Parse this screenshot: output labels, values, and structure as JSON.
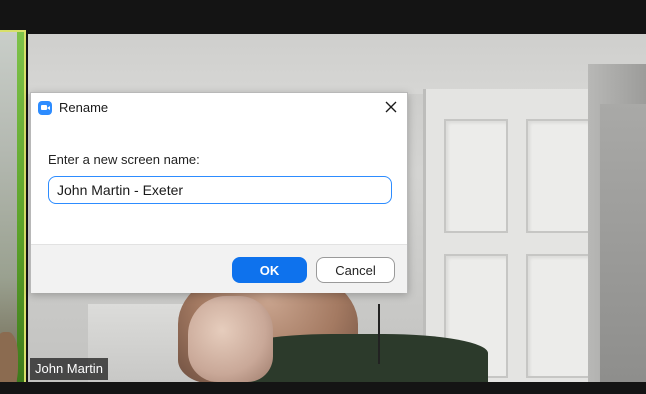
{
  "dialog": {
    "title": "Rename",
    "icon": "zoom-app-icon",
    "prompt": "Enter a new screen name:",
    "input_value": "John Martin - Exeter",
    "ok_label": "OK",
    "cancel_label": "Cancel",
    "close_icon": "close-icon"
  },
  "participant": {
    "name_label": "John Martin"
  },
  "colors": {
    "accent": "#0e72ed",
    "input_border": "#2d8cff",
    "active_speaker_border": "#d8e06a"
  }
}
